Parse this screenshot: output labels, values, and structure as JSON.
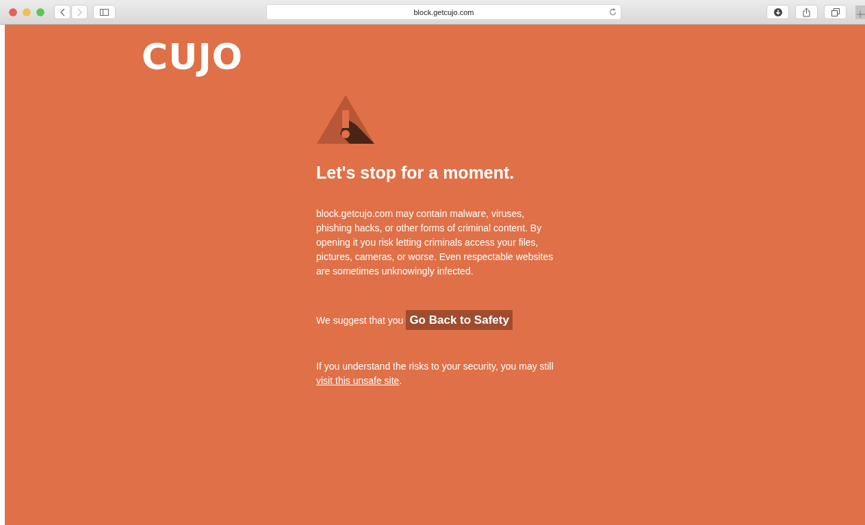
{
  "browser": {
    "url": "block.getcujo.com",
    "nav_buttons": [
      {
        "kind": "back",
        "disabled": false
      },
      {
        "kind": "forward",
        "disabled": true
      }
    ]
  },
  "page": {
    "logo": "CUJO",
    "heading": "Let's stop for a moment.",
    "warning": "block.getcujo.com may contain malware, viruses, phishing hacks, or other forms of criminal content. By opening it you risk letting criminals access your files, pictures, cameras, or worse. Even respectable websites are sometimes unknowingly infected.",
    "suggest": "We suggest that you",
    "safety_button": "Go Back to Safety",
    "risk": {
      "text": "If you understand the risks to your security, you may still",
      "link": "visit this unsafe site",
      "after": "."
    }
  }
}
